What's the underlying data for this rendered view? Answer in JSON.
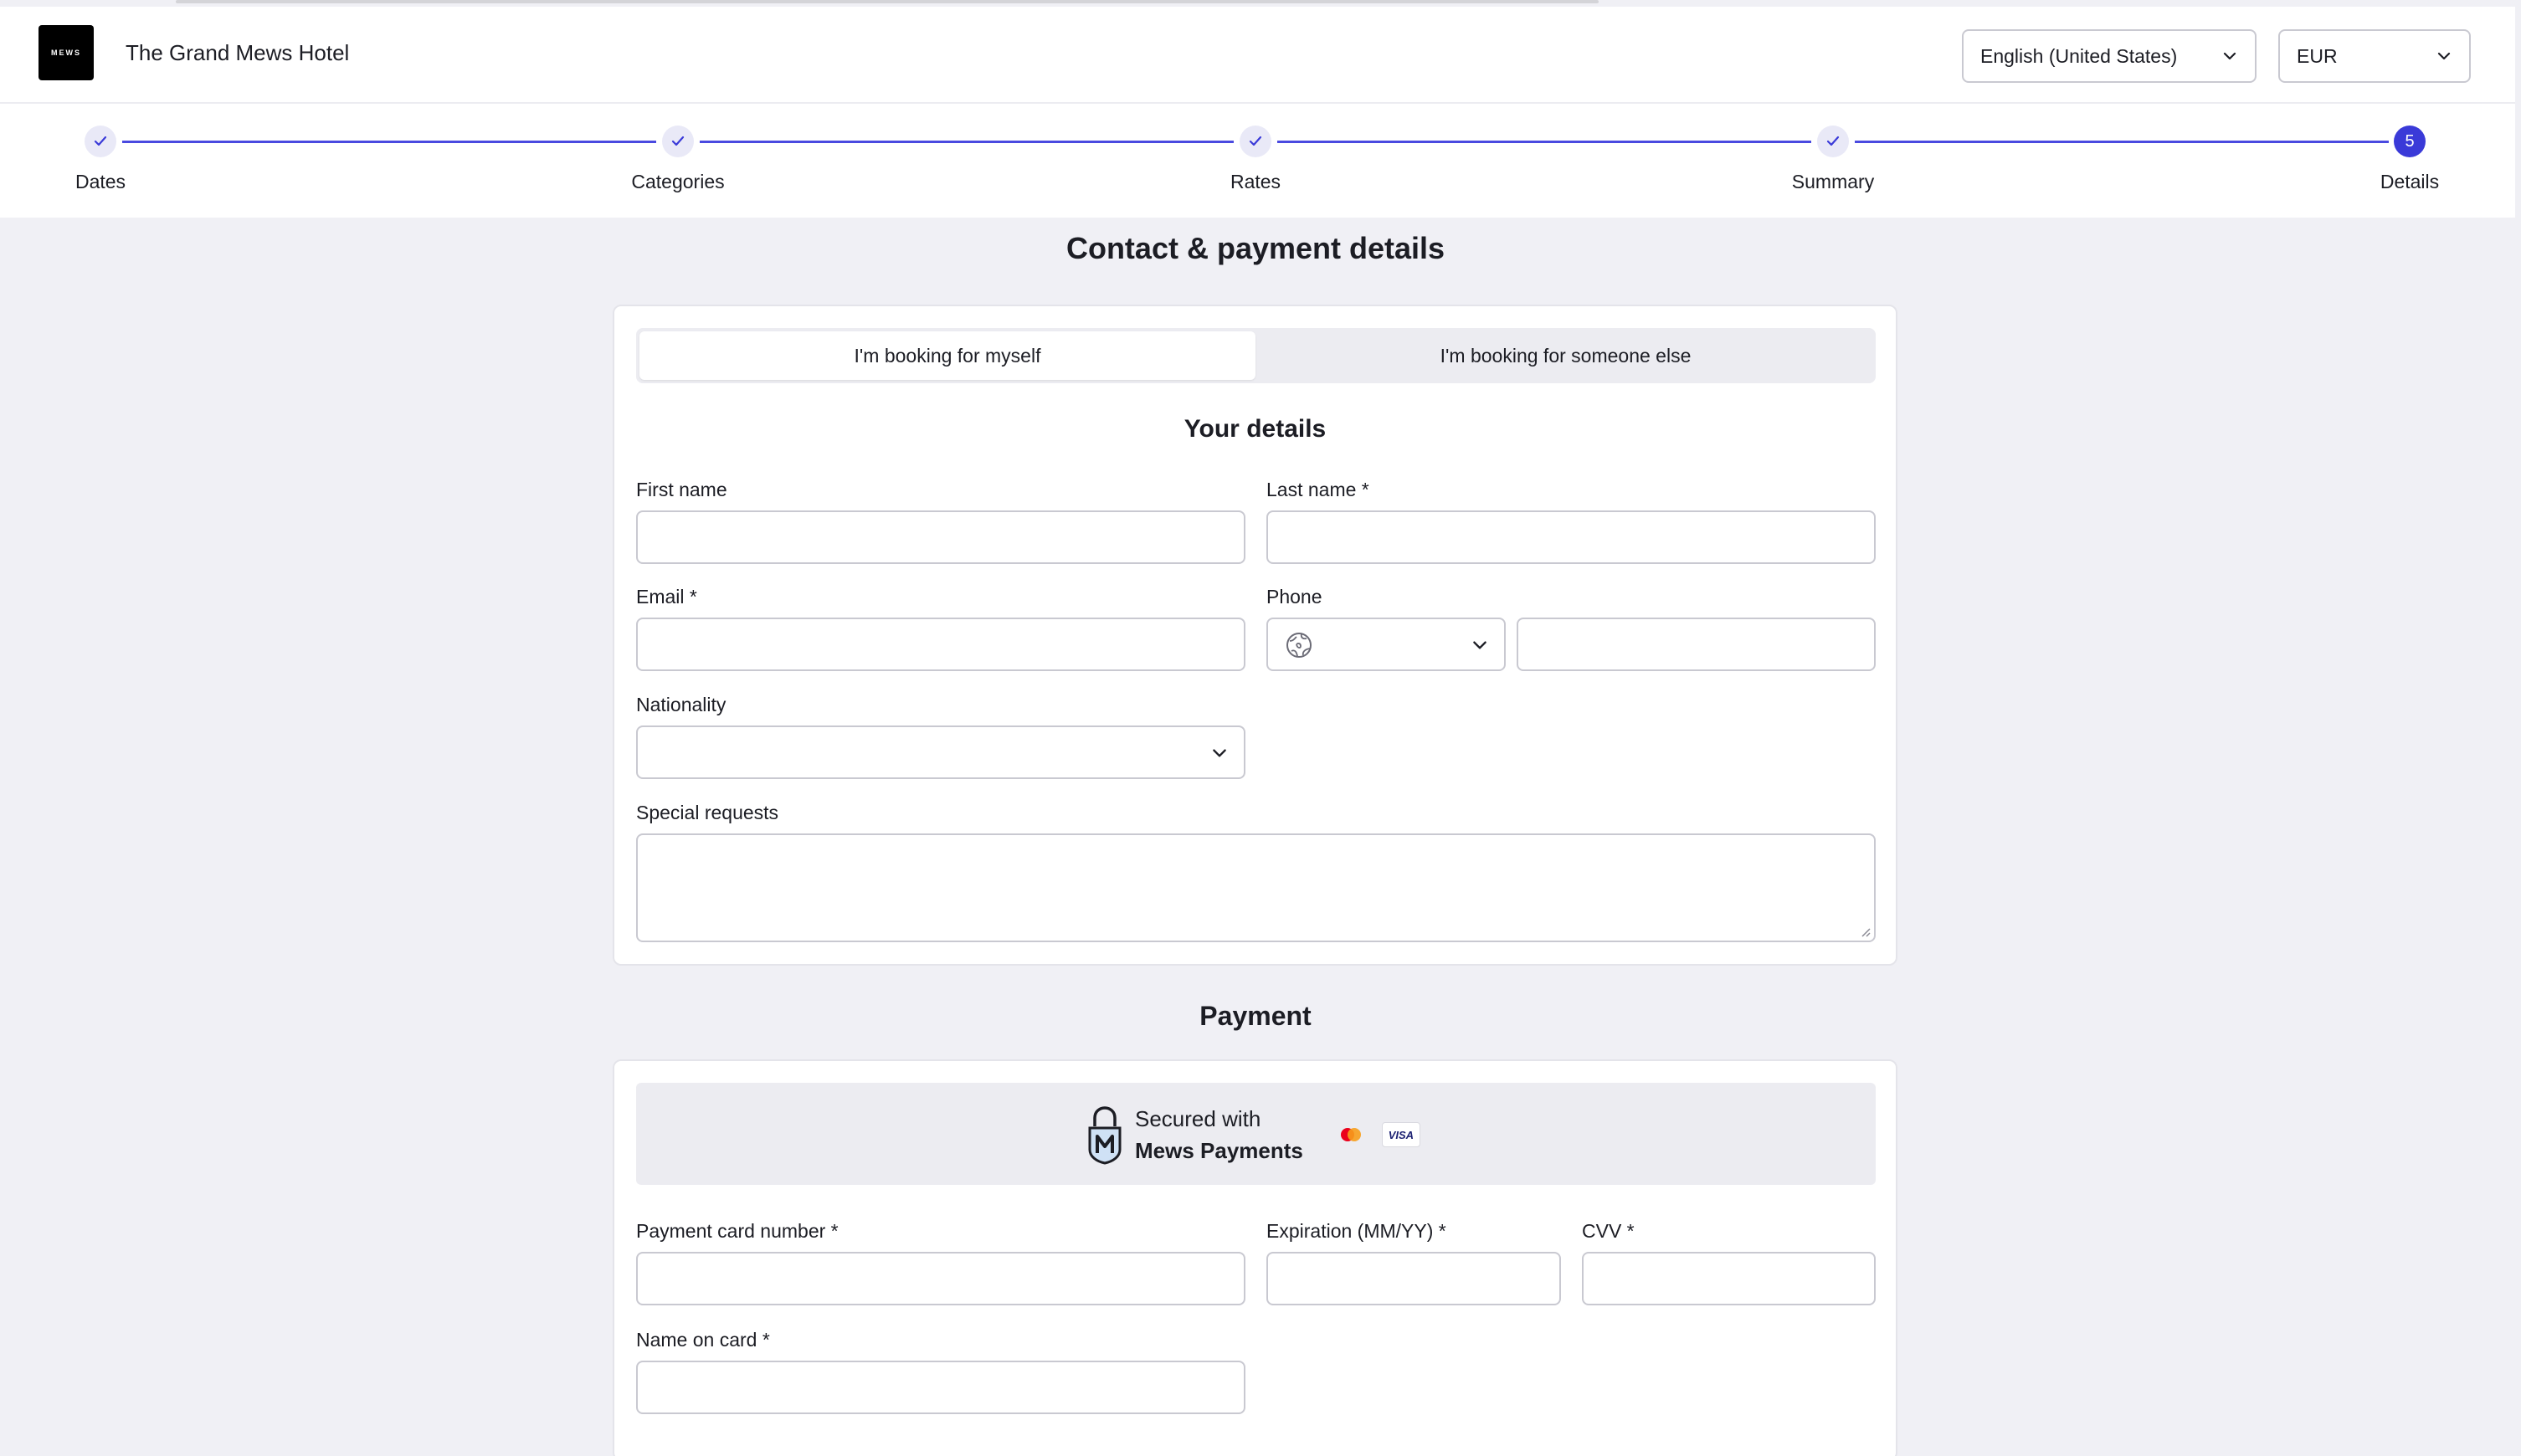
{
  "header": {
    "logo_text": "MEWS",
    "hotel_name": "The Grand Mews Hotel",
    "language": "English (United States)",
    "currency": "EUR"
  },
  "stepper": {
    "steps": [
      {
        "label": "Dates",
        "state": "done"
      },
      {
        "label": "Categories",
        "state": "done"
      },
      {
        "label": "Rates",
        "state": "done"
      },
      {
        "label": "Summary",
        "state": "done"
      },
      {
        "label": "Details",
        "state": "active",
        "number": "5"
      }
    ],
    "accent_color": "#3a3ad8"
  },
  "page_title": "Contact & payment details",
  "booking_toggle": {
    "myself": "I'm booking for myself",
    "someone_else": "I'm booking for someone else",
    "selected": "myself"
  },
  "details": {
    "title": "Your details",
    "first_name": {
      "label": "First name",
      "value": ""
    },
    "last_name": {
      "label": "Last name *",
      "value": ""
    },
    "email": {
      "label": "Email *",
      "value": ""
    },
    "phone": {
      "label": "Phone",
      "country_icon": "globe-icon",
      "value": ""
    },
    "nationality": {
      "label": "Nationality",
      "value": ""
    },
    "special_requests": {
      "label": "Special requests",
      "value": ""
    }
  },
  "payment": {
    "title": "Payment",
    "secured_with": "Secured with",
    "provider": "Mews Payments",
    "card_brands": [
      "mastercard-icon",
      "visa-icon"
    ],
    "visa_text": "VISA",
    "card_number": {
      "label": "Payment card number *",
      "value": ""
    },
    "expiration": {
      "label": "Expiration (MM/YY) *",
      "value": ""
    },
    "cvv": {
      "label": "CVV *",
      "value": ""
    },
    "name_on_card": {
      "label": "Name on card *",
      "value": ""
    }
  }
}
